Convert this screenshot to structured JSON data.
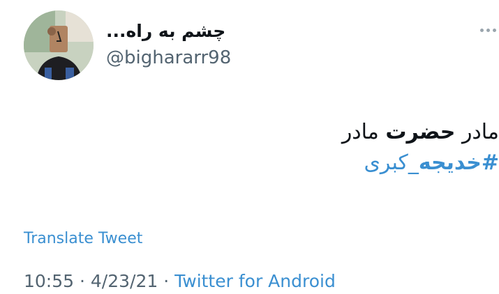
{
  "author": {
    "display_name": "چشم به راه...",
    "handle": "@bighararr98",
    "avatar_icon": "profile-photo"
  },
  "menu": {
    "more_icon": "more-options-icon"
  },
  "tweet": {
    "line1_pre": "مادر ",
    "line1_bold": "حضرت",
    "line1_post": " مادر",
    "hashtag_hash": "#",
    "hashtag_bold": "خدیجه",
    "hashtag_rest": "_کبری"
  },
  "translate_label": "Translate Tweet",
  "meta": {
    "time": "10:55",
    "sep1": " · ",
    "date": "4/23/21",
    "sep2": " · ",
    "source": "Twitter for Android"
  },
  "colors": {
    "link": "#3a8fd1",
    "secondary": "#536471",
    "text": "#0f1419"
  }
}
